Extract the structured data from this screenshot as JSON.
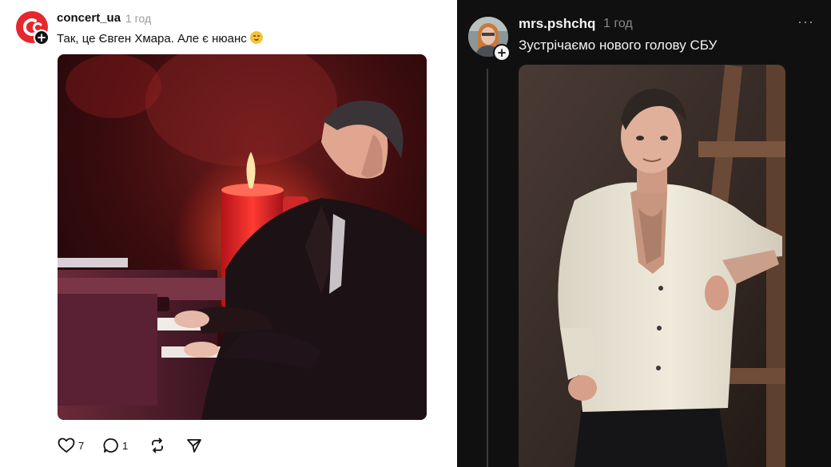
{
  "left_post": {
    "username": "concert_ua",
    "time": "1 год",
    "caption": "Так, це Євген Хмара. Але є нюанс",
    "caption_emoji": "smiling-face-with-hand-over-mouth",
    "avatar_color": "#e8262d",
    "follow_badge": "+",
    "likes": "7",
    "replies": "1",
    "theme": "light"
  },
  "right_post": {
    "username": "mrs.pshchq",
    "time": "1 год",
    "caption": "Зустрічаємо нового голову СБУ",
    "follow_badge": "+",
    "more_menu": "···",
    "theme": "dark",
    "background": "#101010"
  },
  "icons": {
    "like": "heart-icon",
    "reply": "comment-icon",
    "repost": "repost-icon",
    "share": "send-icon",
    "more": "more-icon",
    "follow": "plus-icon"
  }
}
